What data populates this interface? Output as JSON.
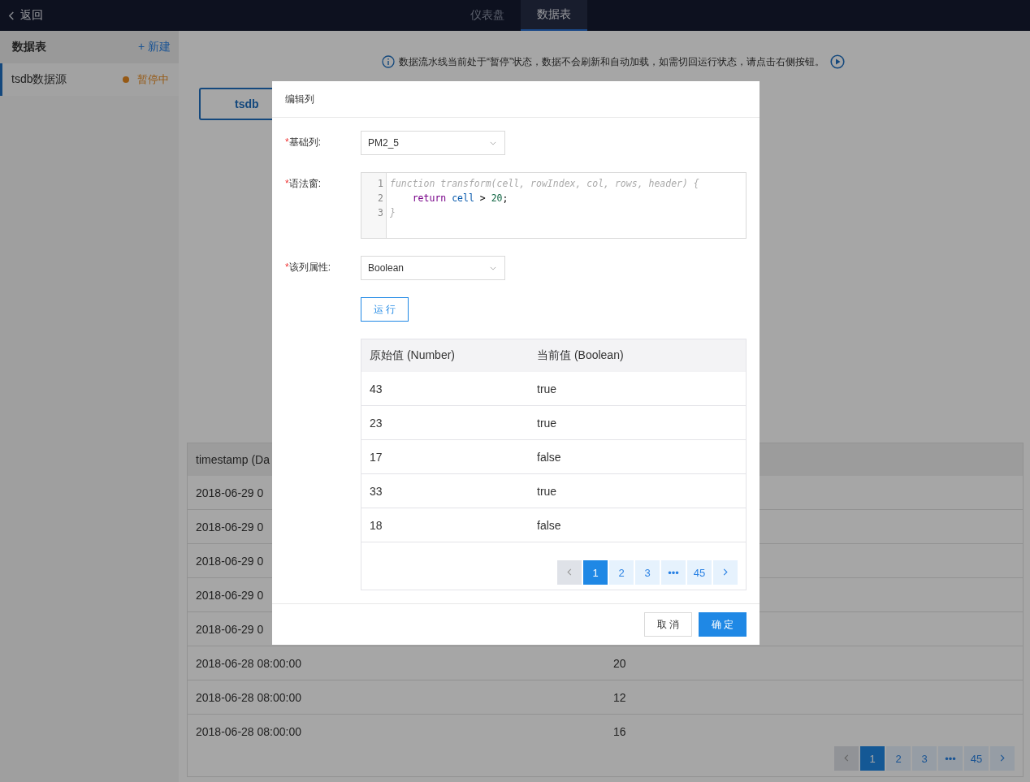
{
  "topbar": {
    "back": "返回",
    "tabs": [
      {
        "label": "仪表盘",
        "selected": false
      },
      {
        "label": "数据表",
        "selected": true
      }
    ]
  },
  "sidebar": {
    "title": "数据表",
    "action": "+ 新建",
    "items": [
      {
        "name": "tsdb数据源",
        "status": "暂停中",
        "selected": true
      }
    ]
  },
  "notice": "数据流水线当前处于“暂停”状态，数据不会刷新和自动加载，如需切回运行状态，请点击右侧按钮。",
  "source_button": "tsdb",
  "table": {
    "columns": [
      "timestamp (Da"
    ],
    "rows": [
      [
        "2018-06-29 0"
      ],
      [
        "2018-06-29 0"
      ],
      [
        "2018-06-29 0"
      ],
      [
        "2018-06-29 0"
      ],
      [
        "2018-06-29 0"
      ],
      [
        "2018-06-28 08:00:00",
        "20"
      ],
      [
        "2018-06-28 08:00:00",
        "12"
      ],
      [
        "2018-06-28 08:00:00",
        "16"
      ]
    ],
    "pagination": [
      {
        "label": "1",
        "selected": true
      },
      {
        "label": "2",
        "selected": false
      },
      {
        "label": "3",
        "selected": false
      },
      {
        "label": "•••",
        "selected": false
      },
      {
        "label": "45",
        "selected": false
      }
    ]
  },
  "modal": {
    "title": "编辑列",
    "fields": [
      {
        "kind": "select",
        "mark": "*",
        "label": "基础列:",
        "value": "PM2_5"
      },
      {
        "kind": "code",
        "mark": "*",
        "label": "语法窗:",
        "lines": [
          {
            "number": "1",
            "tokens": [
              {
                "text": "function transform(cell, rowIndex, col, rows, header) {",
                "kind": "comment"
              }
            ]
          },
          {
            "number": "2",
            "tokens": [
              {
                "text": "    return",
                "kind": "keyword"
              },
              {
                "text": " cell",
                "kind": "variable"
              },
              {
                "text": " >",
                "kind": "plain"
              },
              {
                "text": " 20",
                "kind": "number"
              },
              {
                "text": ";",
                "kind": "plain"
              }
            ]
          },
          {
            "number": "3",
            "tokens": [
              {
                "text": "}",
                "kind": "comment"
              }
            ]
          }
        ]
      },
      {
        "kind": "select",
        "mark": "*",
        "label": "该列属性:",
        "value": "Boolean"
      }
    ],
    "run_button": "运 行",
    "preview": {
      "columns": [
        "原始值 (Number)",
        "当前值 (Boolean)"
      ],
      "rows": [
        [
          "43",
          "true"
        ],
        [
          "23",
          "true"
        ],
        [
          "17",
          "false"
        ],
        [
          "33",
          "true"
        ],
        [
          "18",
          "false"
        ]
      ],
      "pagination": [
        {
          "label": "1",
          "selected": true
        },
        {
          "label": "2",
          "selected": false
        },
        {
          "label": "3",
          "selected": false
        },
        {
          "label": "•••",
          "selected": false
        },
        {
          "label": "45",
          "selected": false
        }
      ]
    },
    "buttons": [
      {
        "label": "取 消",
        "kind": "default"
      },
      {
        "label": "确 定",
        "kind": "primary"
      }
    ]
  }
}
